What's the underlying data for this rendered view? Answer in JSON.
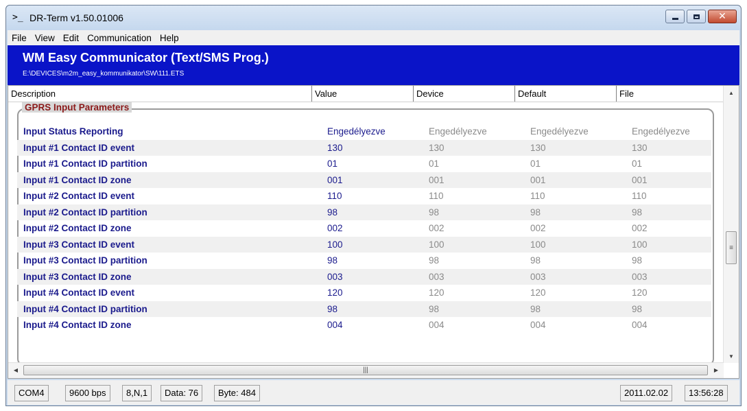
{
  "window": {
    "icon": "terminal-icon",
    "title": "DR-Term  v1.50.01006"
  },
  "menu": [
    "File",
    "View",
    "Edit",
    "Communication",
    "Help"
  ],
  "banner": {
    "title": "WM Easy Communicator (Text/SMS Prog.)",
    "path": "E:\\DEVICES\\m2m_easy_kommunikator\\SW\\111.ETS",
    "background": "#0a14c8"
  },
  "columns": [
    "Description",
    "Value",
    "Device",
    "Default",
    "File"
  ],
  "group_title": "GPRS Input Parameters",
  "rows": [
    {
      "desc": "Input Status Reporting",
      "value": "Engedélyezve",
      "device": "Engedélyezve",
      "default": "Engedélyezve",
      "file": "Engedélyezve"
    },
    {
      "desc": "Input #1 Contact ID event",
      "value": "130",
      "device": "130",
      "default": "130",
      "file": "130"
    },
    {
      "desc": "Input #1 Contact ID partition",
      "value": "01",
      "device": "01",
      "default": "01",
      "file": "01"
    },
    {
      "desc": "Input #1 Contact ID zone",
      "value": "001",
      "device": "001",
      "default": "001",
      "file": "001"
    },
    {
      "desc": "Input #2 Contact ID event",
      "value": "110",
      "device": "110",
      "default": "110",
      "file": "110"
    },
    {
      "desc": "Input #2 Contact ID partition",
      "value": "98",
      "device": "98",
      "default": "98",
      "file": "98"
    },
    {
      "desc": "Input #2 Contact ID zone",
      "value": "002",
      "device": "002",
      "default": "002",
      "file": "002"
    },
    {
      "desc": "Input #3 Contact ID event",
      "value": "100",
      "device": "100",
      "default": "100",
      "file": "100"
    },
    {
      "desc": "Input #3 Contact ID partition",
      "value": "98",
      "device": "98",
      "default": "98",
      "file": "98"
    },
    {
      "desc": "Input #3 Contact ID zone",
      "value": "003",
      "device": "003",
      "default": "003",
      "file": "003"
    },
    {
      "desc": "Input #4 Contact ID event",
      "value": "120",
      "device": "120",
      "default": "120",
      "file": "120"
    },
    {
      "desc": "Input #4 Contact ID partition",
      "value": "98",
      "device": "98",
      "default": "98",
      "file": "98"
    },
    {
      "desc": "Input #4 Contact ID zone",
      "value": "004",
      "device": "004",
      "default": "004",
      "file": "004"
    }
  ],
  "status": {
    "port": "COM4",
    "baud": "9600 bps",
    "format": "8,N,1",
    "data": "Data: 76",
    "byte": "Byte: 484",
    "date": "2011.02.02",
    "time": "13:56:28"
  },
  "colors": {
    "value_text": "#1a1a8c",
    "inactive_text": "#8a8a8a",
    "group_title": "#8b1a1a"
  }
}
